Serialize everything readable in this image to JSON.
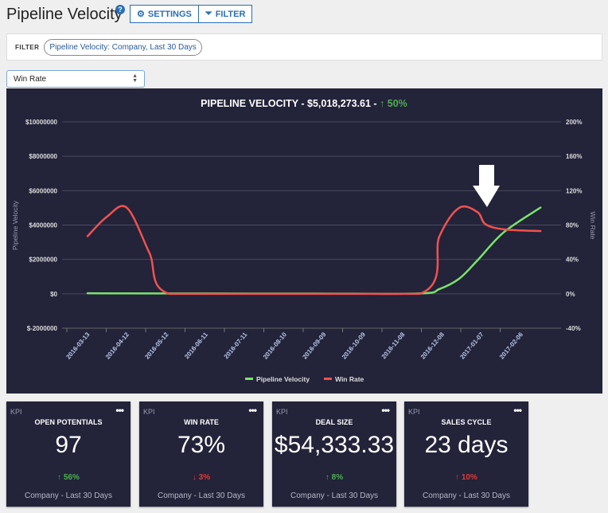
{
  "header": {
    "title": "Pipeline Velocity",
    "help_icon": "question-circle-icon",
    "settings_label": "SETTINGS",
    "filter_label": "FILTER"
  },
  "filter_bar": {
    "label": "FILTER",
    "chip": "Pipeline Velocity: Company, Last 30 Days"
  },
  "metric_select": {
    "value": "Win Rate"
  },
  "chart_title": {
    "text": "PIPELINE VELOCITY - $5,018,273.61 - ",
    "change_arrow": "↑",
    "change": "50%",
    "change_color": "#4caf50"
  },
  "annotation": {
    "icon": "down-arrow-icon"
  },
  "chart_data": {
    "type": "line",
    "x_tick_labels": [
      "2016-03-13",
      "2016-04-12",
      "2016-05-12",
      "2016-06-11",
      "2016-07-11",
      "2016-08-10",
      "2016-09-09",
      "2016-10-09",
      "2016-11-08",
      "2016-12-08",
      "2017-01-07",
      "2017-02-06"
    ],
    "ylabel": "Pipeline Velocity",
    "ylabel_right": "Win Rate",
    "ylim": [
      -2000000,
      10000000
    ],
    "ylim_right": [
      -40,
      200
    ],
    "y_ticks": [
      "$10000000",
      "$8000000",
      "$6000000",
      "$4000000",
      "$2000000",
      "$0",
      "$-2000000"
    ],
    "y_ticks_right": [
      "200%",
      "160%",
      "120%",
      "80%",
      "40%",
      "0%",
      "-40%"
    ],
    "grid": true,
    "legend_position": "bottom",
    "series": [
      {
        "name": "Pipeline Velocity",
        "axis": "left",
        "color": "#7be36b",
        "points": [
          [
            "2016-03-13",
            30000
          ],
          [
            "2016-06-01",
            20000
          ],
          [
            "2016-09-01",
            15000
          ],
          [
            "2016-11-21",
            20000
          ],
          [
            "2016-12-06",
            280000
          ],
          [
            "2016-12-21",
            880000
          ],
          [
            "2017-01-04",
            1950000
          ],
          [
            "2017-01-24",
            3580000
          ],
          [
            "2017-02-21",
            5018273.61
          ]
        ]
      },
      {
        "name": "Win Rate",
        "axis": "right",
        "color": "#f0524f",
        "points": [
          [
            "2016-03-13",
            67
          ],
          [
            "2016-03-28",
            90
          ],
          [
            "2016-04-12",
            100
          ],
          [
            "2016-04-29",
            48
          ],
          [
            "2016-05-14",
            0
          ],
          [
            "2016-08-01",
            0
          ],
          [
            "2016-11-21",
            0
          ],
          [
            "2016-12-06",
            67
          ],
          [
            "2016-12-21",
            100
          ],
          [
            "2017-01-04",
            95
          ],
          [
            "2017-01-10",
            81
          ],
          [
            "2017-01-24",
            75
          ],
          [
            "2017-02-21",
            73
          ]
        ]
      }
    ]
  },
  "kpis": [
    {
      "tag": "KPI",
      "title": "OPEN POTENTIALS",
      "value": "97",
      "arrow": "↑",
      "change": "56%",
      "dir": "up",
      "footer": "Company - Last 30 Days"
    },
    {
      "tag": "KPI",
      "title": "WIN RATE",
      "value": "73%",
      "arrow": "↓",
      "change": "3%",
      "dir": "down",
      "footer": "Company - Last 30 Days"
    },
    {
      "tag": "KPI",
      "title": "DEAL SIZE",
      "value": "$54,333.33",
      "arrow": "↑",
      "change": "8%",
      "dir": "up",
      "footer": "Company - Last 30 Days"
    },
    {
      "tag": "KPI",
      "title": "SALES CYCLE",
      "value": "23 days",
      "arrow": "↑",
      "change": "10%",
      "dir": "up-bad",
      "footer": "Company - Last 30 Days"
    }
  ]
}
